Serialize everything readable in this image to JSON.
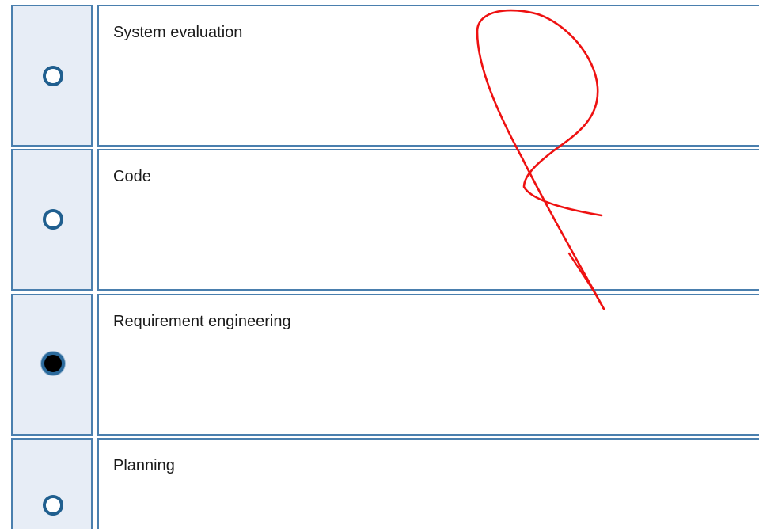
{
  "options": [
    {
      "label": "System evaluation",
      "selected": false
    },
    {
      "label": "Code",
      "selected": false
    },
    {
      "label": "Requirement engineering",
      "selected": true
    },
    {
      "label": "Planning",
      "selected": false
    }
  ],
  "colors": {
    "border": "#4a7fae",
    "radio_cell_bg": "#e7edf6",
    "radio_ring": "#205f8f",
    "annotation_stroke": "#ee1111"
  }
}
